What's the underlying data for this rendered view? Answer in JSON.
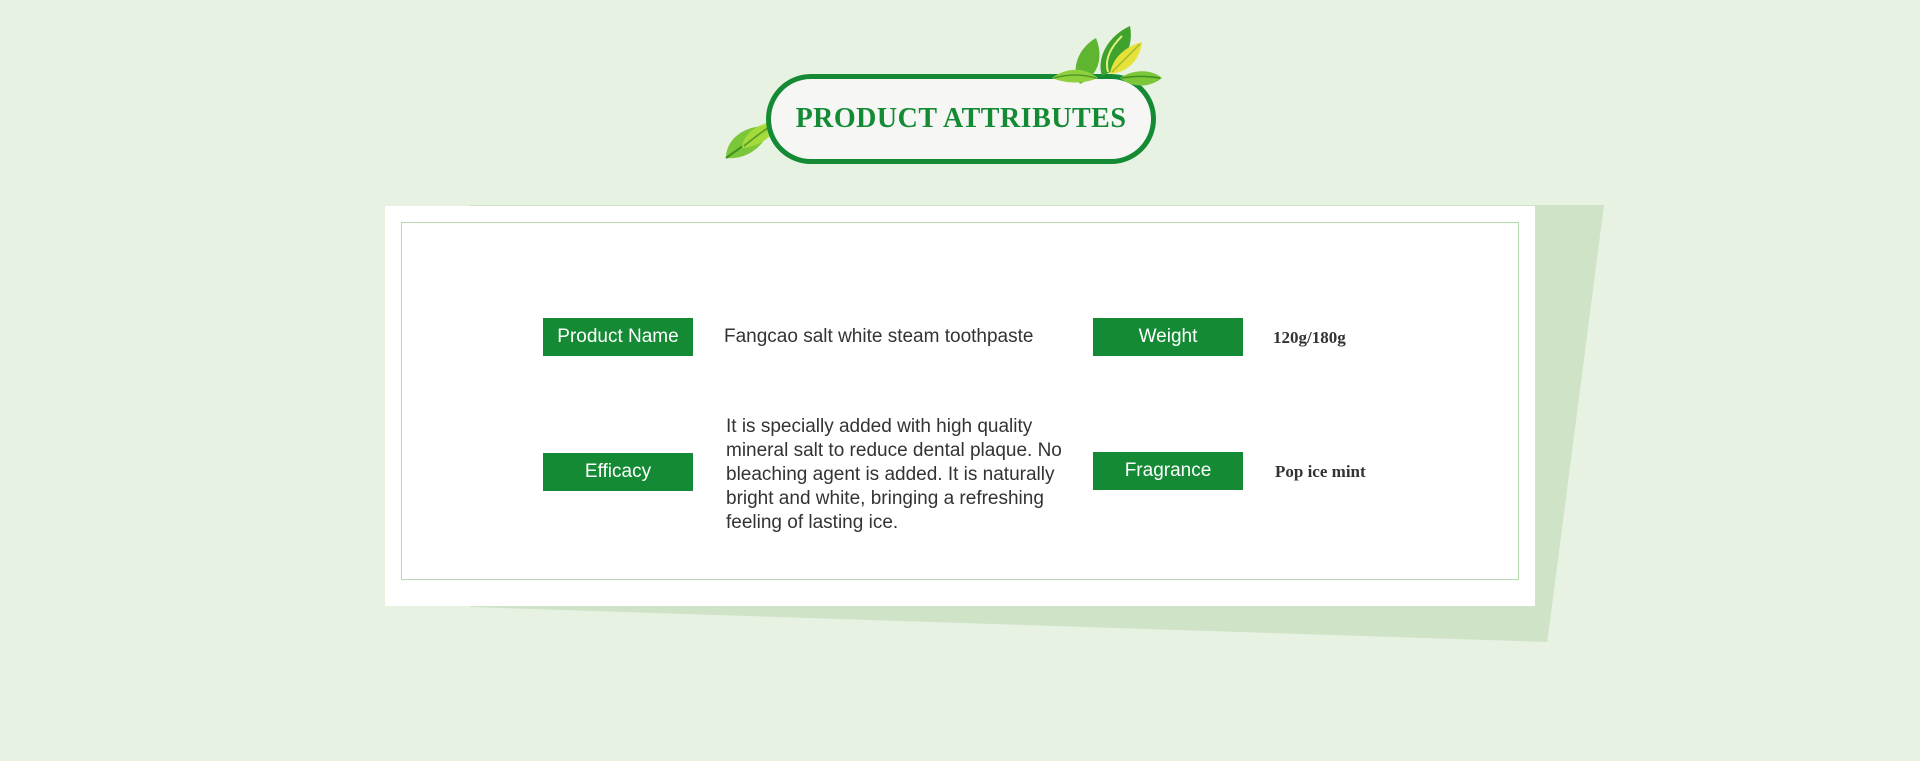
{
  "header": {
    "title": "PRODUCT ATTRIBUTES"
  },
  "attributes": {
    "product_name": {
      "label": "Product Name",
      "value": "Fangcao salt white steam toothpaste"
    },
    "weight": {
      "label": "Weight",
      "value": "120g/180g"
    },
    "efficacy": {
      "label": "Efficacy",
      "value": "It is specially added with high quality mineral salt to reduce dental plaque. No bleaching agent is added. It is naturally bright and white, bringing a refreshing feeling of lasting ice."
    },
    "fragrance": {
      "label": "Fragrance",
      "value": "Pop ice mint"
    }
  },
  "colors": {
    "brand_green": "#148a34",
    "background": "#e7f2e3",
    "shadow": "#cfe3c7",
    "border": "#b6dbae"
  },
  "icons": [
    "leaf-cluster-icon",
    "leaf-icon"
  ]
}
